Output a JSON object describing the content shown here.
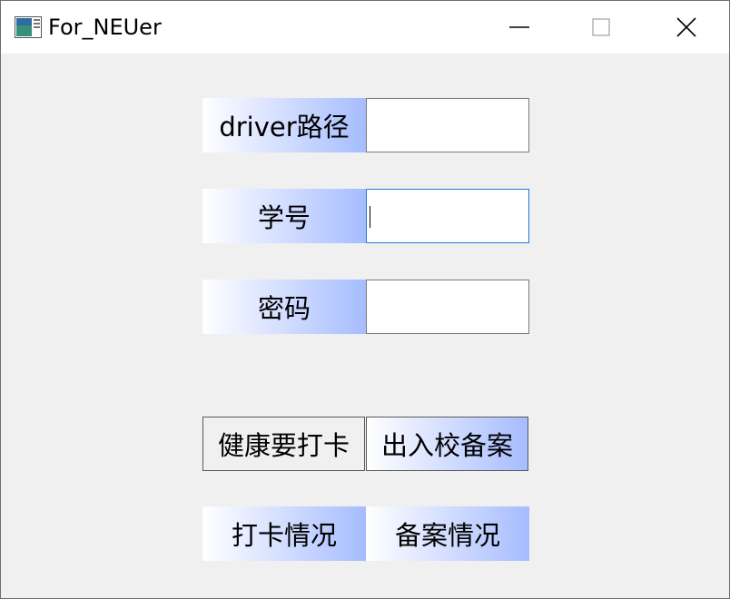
{
  "window": {
    "title": "For_NEUer"
  },
  "form": {
    "driver_label": "driver路径",
    "driver_value": "",
    "id_label": "学号",
    "id_value": "",
    "password_label": "密码",
    "password_value": ""
  },
  "buttons": {
    "health_checkin": "健康要打卡",
    "campus_record": "出入校备案",
    "checkin_status": "打卡情况",
    "record_status": "备案情况"
  },
  "colors": {
    "gradient_end": "#a6bcff",
    "focus_border": "#1f7bd6"
  }
}
